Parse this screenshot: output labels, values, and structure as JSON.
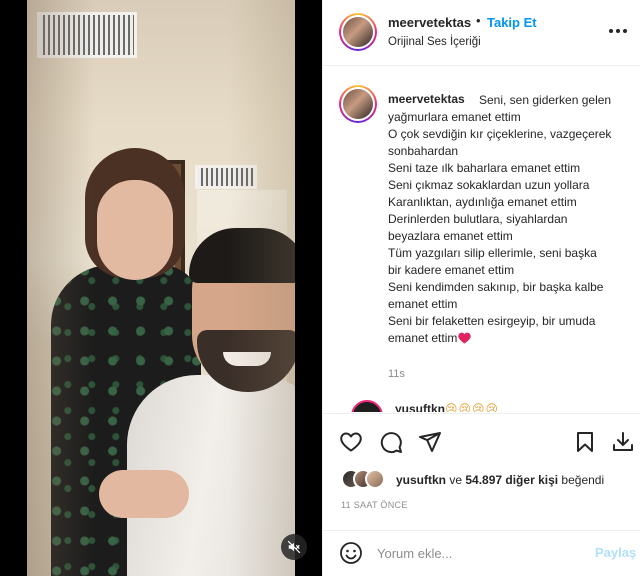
{
  "post": {
    "username": "meervetektas",
    "follow_label": "Takip Et",
    "audio_label": "Orijinal Ses İçeriği",
    "separator": "•"
  },
  "caption": {
    "username": "meervetektas",
    "lines": [
      "Seni, sen giderken gelen",
      "yağmurlara emanet ettim",
      "O çok sevdiğin kır çiçeklerine, vazgeçerek",
      "sonbahardan",
      "Seni taze ılk baharlara emanet ettim",
      "Seni çıkmaz sokaklardan uzun yollara",
      "Karanlıktan, aydınlığa emanet ettim",
      "Derinlerden bulutlara, siyahlardan",
      "beyazlara emanet ettim",
      "Tüm yazgıları silip ellerimle, seni başka",
      "bir kadere emanet ettim",
      "Seni kendimden sakınıp, bir başka kalbe",
      "emanet ettim",
      "Seni bir felaketten esirgeyip, bir umuda",
      "emanet ettim"
    ],
    "trailing_emoji": "red-heart",
    "time_ago": "11s"
  },
  "comment_peek": {
    "username": "yusuftkn",
    "emojis": "😢😢😢😢"
  },
  "actions": {
    "like_icon": "heart-outline-icon",
    "comment_icon": "comment-icon",
    "share_icon": "send-icon",
    "save_icon": "bookmark-icon",
    "download_icon": "download-icon"
  },
  "likes": {
    "first_user": "yusuftkn",
    "middle": " ve ",
    "others": "54.897 diğer kişi",
    "suffix": " beğendi"
  },
  "post_time": "11 SAAT ÖNCE",
  "comment_form": {
    "placeholder": "Yorum ekle...",
    "post_label": "Paylaş"
  },
  "colors": {
    "accent": "#0095f6",
    "post_disabled": "#b2dffc",
    "heart": "#ed4956"
  }
}
